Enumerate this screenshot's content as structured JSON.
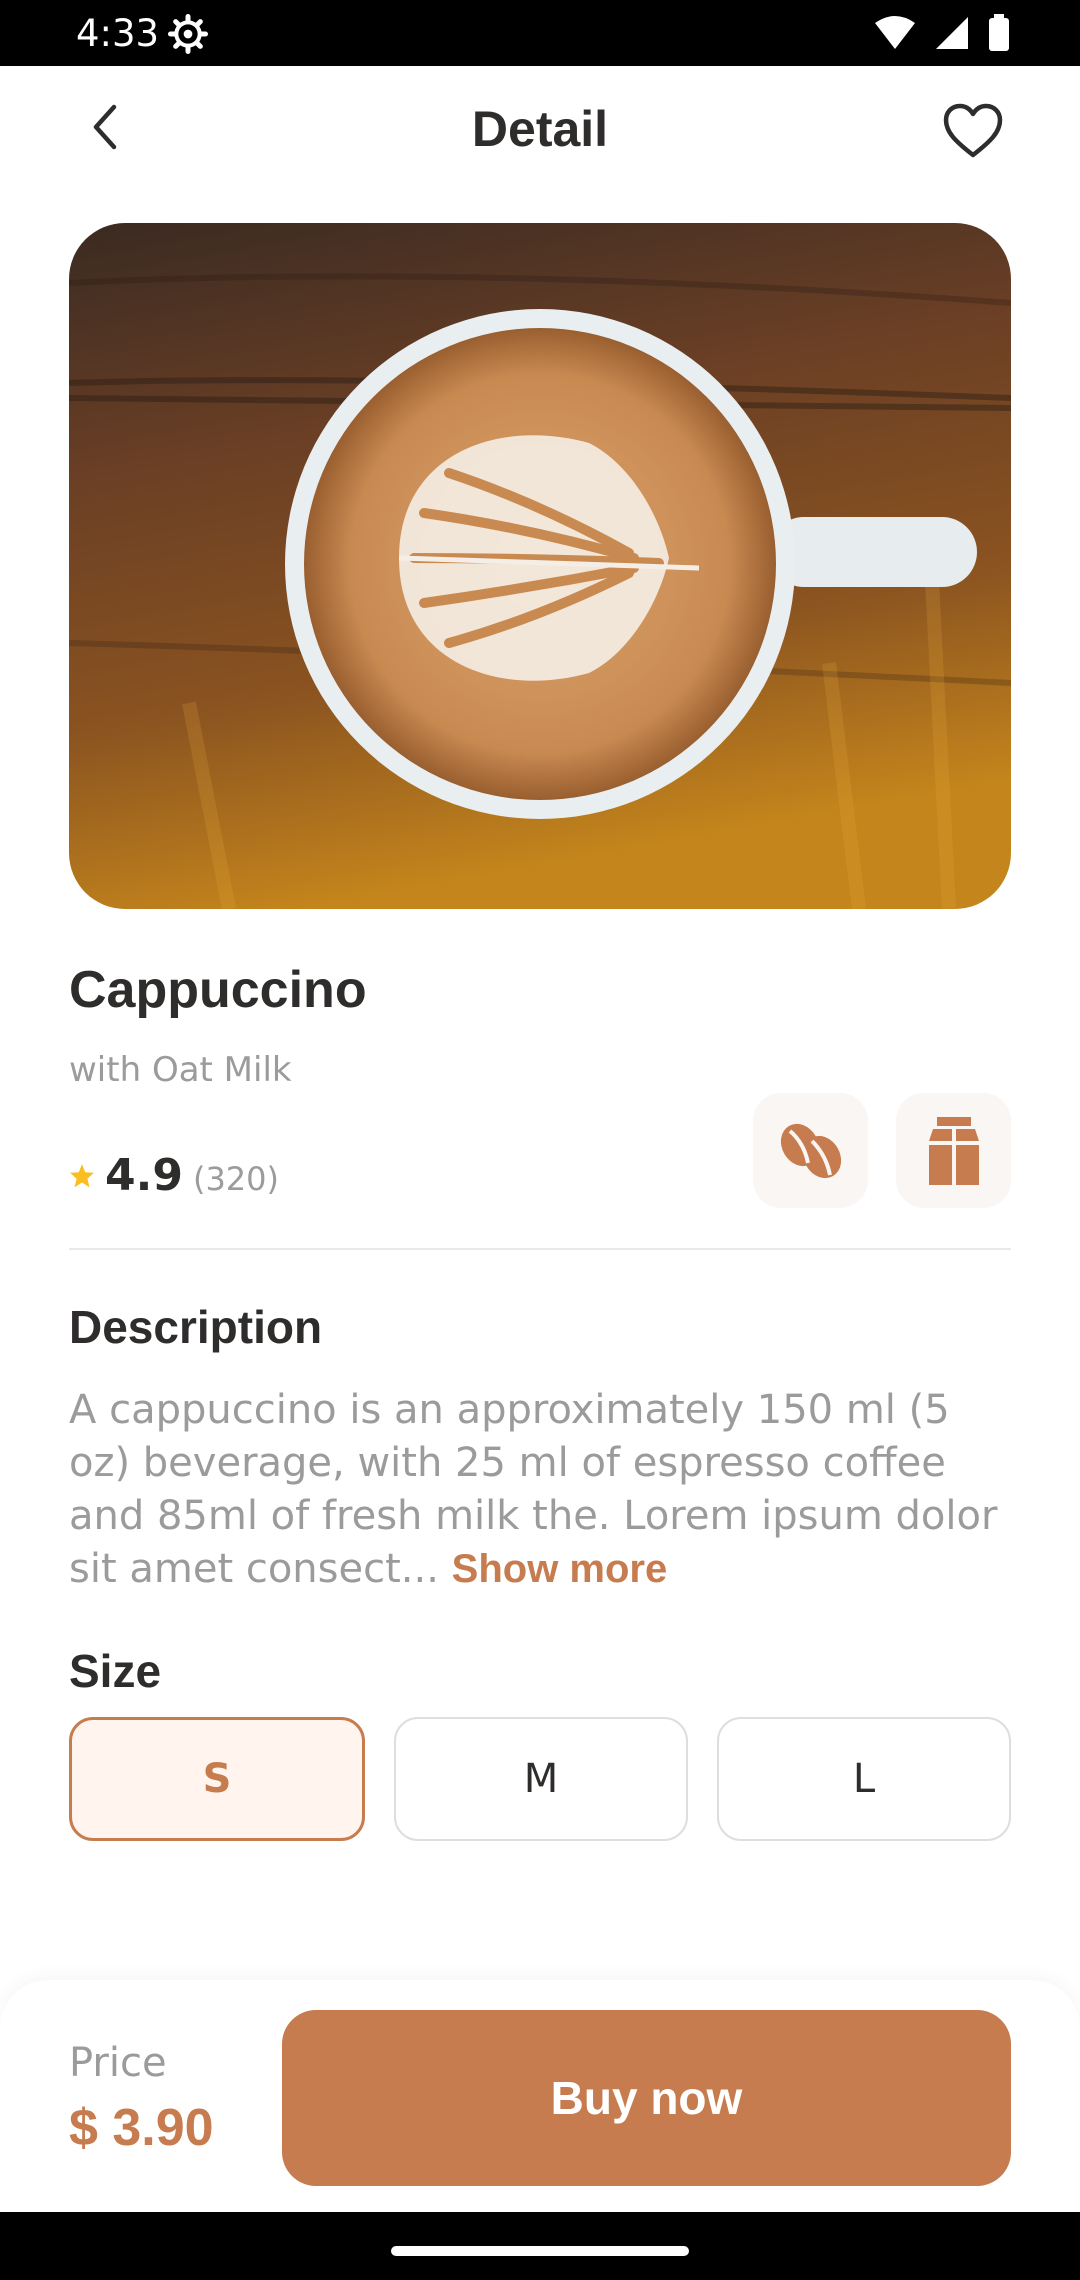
{
  "status_bar": {
    "time": "4:33",
    "icons": [
      "settings-icon",
      "wifi-icon",
      "signal-icon",
      "battery-icon"
    ]
  },
  "header": {
    "title": "Detail",
    "back_icon": "chevron-left-icon",
    "favorite_icon": "heart-outline-icon"
  },
  "product": {
    "name": "Cappuccino",
    "subtitle": "with Oat Milk",
    "rating": "4.9",
    "rating_count": "(320)",
    "features": [
      "coffee-bean-icon",
      "milk-carton-icon"
    ]
  },
  "description": {
    "title": "Description",
    "text": "A cappuccino is an approximately 150 ml (5 oz) beverage, with 25 ml of espresso coffee and 85ml of fresh milk the.  Lorem ipsum dolor sit amet consect...",
    "show_more": "Show more"
  },
  "size": {
    "title": "Size",
    "options": [
      "S",
      "M",
      "L"
    ],
    "selected": "S"
  },
  "checkout": {
    "price_label": "Price",
    "price": "$ 3.90",
    "buy_label": "Buy now"
  },
  "colors": {
    "accent": "#C67C4E",
    "accent_light": "#FFF5EE",
    "text_dark": "#2F2D2C",
    "text_muted": "#9B9B9B",
    "star": "#FBBE21"
  }
}
